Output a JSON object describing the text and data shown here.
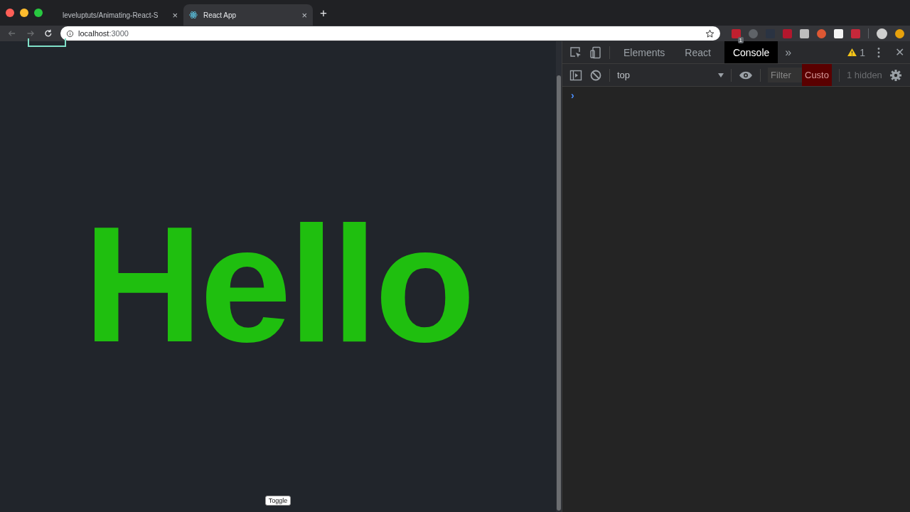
{
  "browser_tabs": [
    {
      "title": "leveluptuts/Animating-React-S",
      "close": "×",
      "selected": false
    },
    {
      "title": "React App",
      "close": "×",
      "selected": true
    }
  ],
  "new_tab": "+",
  "address_bar": {
    "host": "localhost",
    "port": ":3000"
  },
  "extension_badge": "1",
  "page": {
    "heading": "Hello",
    "button": "Toggle"
  },
  "devtools": {
    "tabs": [
      {
        "label": "Elements",
        "selected": false
      },
      {
        "label": "React",
        "selected": false
      },
      {
        "label": "Console",
        "selected": true
      }
    ],
    "more": "»",
    "warnings": "1",
    "close": "✕",
    "context": "top",
    "filter_placeholder": "Filter",
    "custom_levels": "Custo",
    "hidden": "1 hidden",
    "prompt": "›"
  }
}
